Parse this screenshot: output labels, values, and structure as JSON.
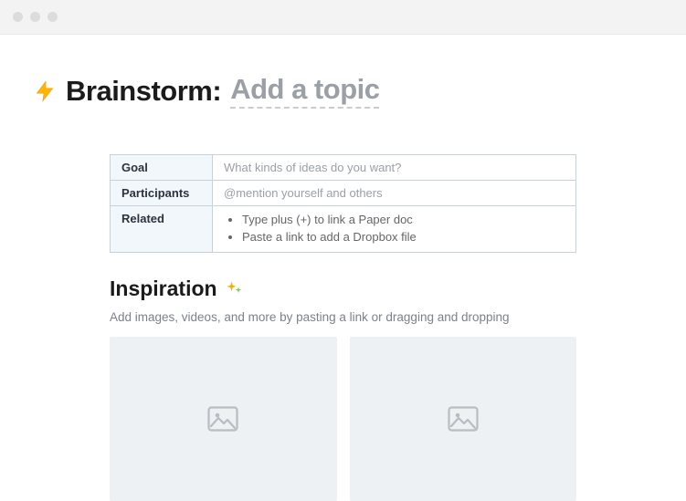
{
  "title": {
    "icon": "bolt-icon",
    "prefix": "Brainstorm:",
    "placeholder": "Add a topic"
  },
  "meta": {
    "rows": [
      {
        "label": "Goal",
        "placeholder": "What kinds of ideas do you want?"
      },
      {
        "label": "Participants",
        "placeholder": "@mention yourself and others"
      },
      {
        "label": "Related",
        "items": [
          "Type plus (+) to link a Paper doc",
          "Paste a link to add a Dropbox file"
        ]
      }
    ]
  },
  "inspiration": {
    "heading": "Inspiration",
    "icon": "sparkles-icon",
    "subtext": "Add images, videos, and more by pasting a link or dragging and dropping",
    "placeholders": 2
  }
}
